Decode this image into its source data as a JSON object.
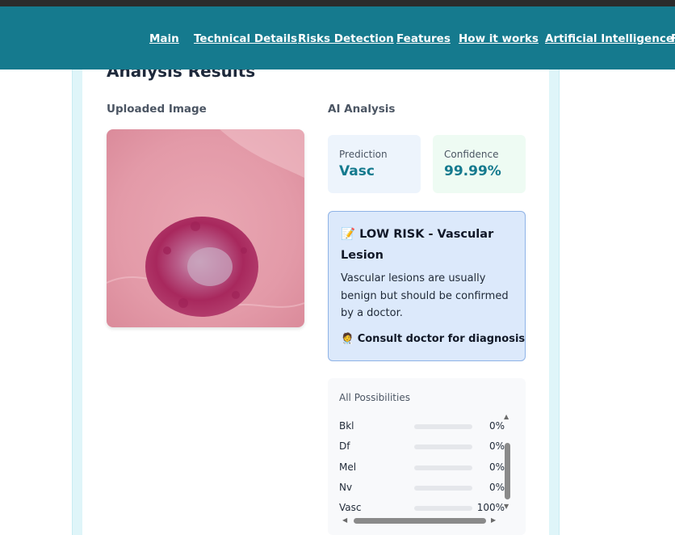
{
  "nav": {
    "links": [
      "Main",
      "Technical Details",
      "Risks Detection",
      "Features",
      "How it works",
      "Artificial Intelligence",
      "F"
    ]
  },
  "page": {
    "title": "Analysis Results",
    "uploaded_label": "Uploaded Image",
    "ai_label": "AI Analysis"
  },
  "prediction": {
    "label": "Prediction",
    "value": "Vasc"
  },
  "confidence": {
    "label": "Confidence",
    "value": "99.99%"
  },
  "risk": {
    "icon": "memo-icon",
    "title": "📝 LOW RISK - Vascular Lesion",
    "description": "Vascular lesions are usually benign but should be confirmed by a doctor.",
    "action": "🧑‍⚕️ Consult doctor for diagnosis",
    "action_icon": "doctor-icon"
  },
  "possibilities": {
    "title": "All Possibilities",
    "items": [
      {
        "name": "Bkl",
        "percent": "0%",
        "fraction": 0
      },
      {
        "name": "Df",
        "percent": "0%",
        "fraction": 0
      },
      {
        "name": "Mel",
        "percent": "0%",
        "fraction": 0
      },
      {
        "name": "Nv",
        "percent": "0%",
        "fraction": 0
      },
      {
        "name": "Vasc",
        "percent": "100%",
        "fraction": 1
      }
    ]
  },
  "colors": {
    "nav_bg": "#157a8e",
    "accent": "#157a8e",
    "bar_fill": "#18b3d1",
    "risk_bg": "#dce9fb",
    "risk_border": "#8fb3e6"
  }
}
